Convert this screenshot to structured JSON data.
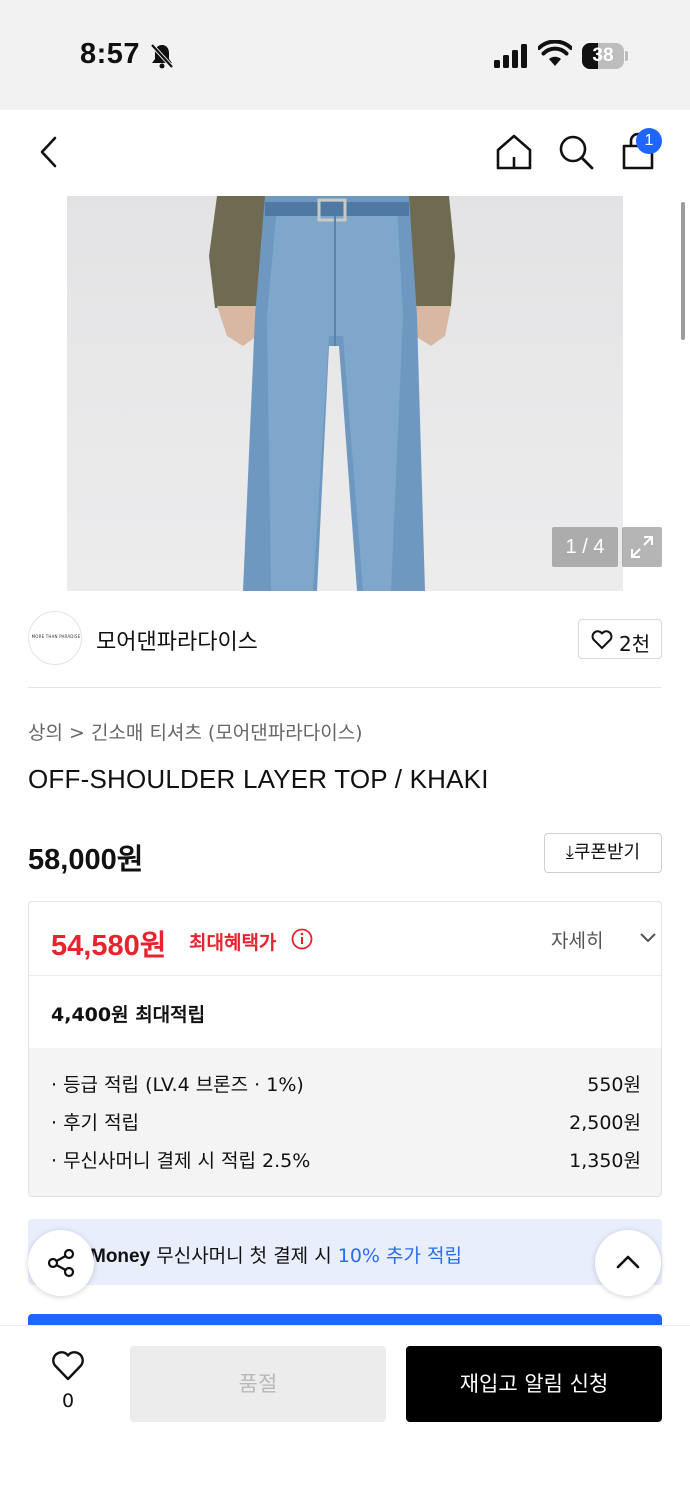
{
  "status_bar": {
    "time": "8:57",
    "battery": "38"
  },
  "nav": {
    "cart_count": "1"
  },
  "gallery": {
    "counter": "1 / 4",
    "current_image": 1,
    "total_images": 4
  },
  "brand": {
    "name": "모어댄파라다이스",
    "logo_text": "MORE THAN PARADISE",
    "likes": "2천"
  },
  "breadcrumb": "상의 > 긴소매 티셔츠 (모어댄파라다이스)",
  "product": {
    "title": "OFF-SHOULDER LAYER TOP / KHAKI",
    "price": "58,000원",
    "coupon_label": "쿠폰받기"
  },
  "benefit": {
    "max_price": "54,580원",
    "max_label": "최대혜택가",
    "detail_label": "자세히",
    "max_points": "4,400원 최대적립",
    "rows": [
      {
        "label": "· 등급 적립 (LV.4 브론즈 · 1%)",
        "value": "550원"
      },
      {
        "label": "· 후기 적립",
        "value": "2,500원"
      },
      {
        "label": "· 무신사머니 결제 시 적립 2.5%",
        "value": "1,350원"
      }
    ]
  },
  "money_banner": {
    "brand": "Money",
    "text": "무신사머니 첫 결제 시",
    "highlight": "10% 추가 적립"
  },
  "bottom_bar": {
    "wish_count": "0",
    "soldout_label": "품절",
    "notify_label": "재입고 알림 신청"
  },
  "colors": {
    "accent_blue": "#1f66ff",
    "sale_red": "#e8232e",
    "banner_bg": "#e8eefc"
  }
}
